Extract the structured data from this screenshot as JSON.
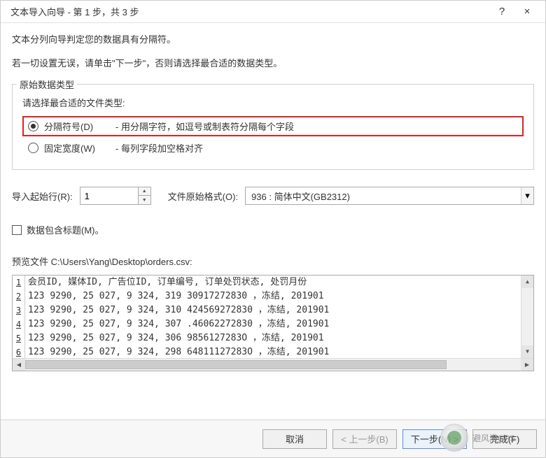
{
  "titlebar": {
    "title": "文本导入向导 - 第 1 步，共 3 步",
    "help": "?",
    "close": "×"
  },
  "intro": {
    "line1": "文本分列向导判定您的数据具有分隔符。",
    "line2": "若一切设置无误，请单击\"下一步\"，否则请选择最合适的数据类型。"
  },
  "fieldset": {
    "legend": "原始数据类型",
    "label": "请选择最合适的文件类型:",
    "radio1_label": "分隔符号(D)",
    "radio1_desc": "- 用分隔字符，如逗号或制表符分隔每个字段",
    "radio2_label": "固定宽度(W)",
    "radio2_desc": "- 每列字段加空格对齐"
  },
  "controls": {
    "start_row_label": "导入起始行(R):",
    "start_row_value": "1",
    "encoding_label": "文件原始格式(O):",
    "encoding_value": "936 : 简体中文(GB2312)"
  },
  "checkbox": {
    "label": "数据包含标题(M)。"
  },
  "preview": {
    "label": "预览文件 C:\\Users\\Yang\\Desktop\\orders.csv:",
    "lines": [
      {
        "num": "1",
        "text": "会员ID, 媒体ID, 广告位ID, 订单编号, 订单处罚状态, 处罚月份"
      },
      {
        "num": "2",
        "prefix": "123",
        "mid1": "9290, 25",
        "mid2": "027, 9",
        "mid3": "324, 319",
        "suffix": "30917272830 ，冻结, 201901"
      },
      {
        "num": "3",
        "prefix": "123",
        "mid1": "9290, 25",
        "mid2": "027, 9",
        "mid3": "324, 310",
        "suffix": "424569272830 ，冻结, 201901"
      },
      {
        "num": "4",
        "prefix": "123",
        "mid1": "9290, 25",
        "mid2": "027, 9",
        "mid3": "324, 307",
        "suffix": ".46062272830 ，冻结, 201901"
      },
      {
        "num": "5",
        "prefix": "123",
        "mid1": "9290, 25",
        "mid2": "027, 9",
        "mid3": "324, 306",
        "suffix": "9856127283O ，冻结, 201901"
      },
      {
        "num": "6",
        "prefix": "123",
        "mid1": "9290, 25",
        "mid2": "027, 9",
        "mid3": "324, 298",
        "suffix": "64811127283O ，冻结, 201901"
      }
    ]
  },
  "footer": {
    "cancel": "取消",
    "back": "< 上一步(B)",
    "next": "下一步(N) >",
    "finish": "完成(F)"
  },
  "watermark": {
    "text": "避风港GPS"
  }
}
